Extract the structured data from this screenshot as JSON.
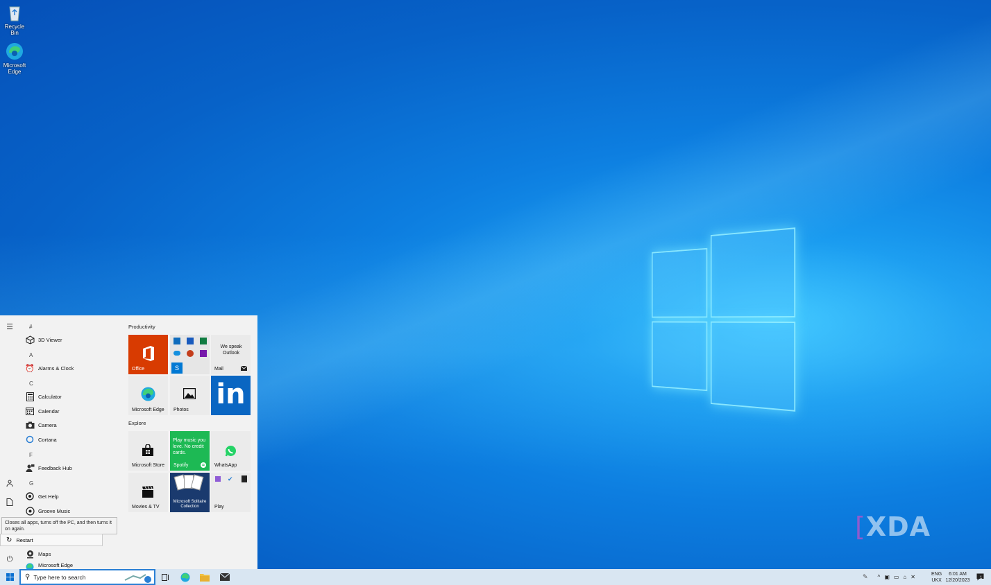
{
  "desktop": {
    "icons": [
      {
        "label": "Recycle Bin",
        "icon": "recycle-bin-icon"
      },
      {
        "label": "Microsoft Edge",
        "icon": "edge-icon"
      }
    ],
    "watermark": "XDA"
  },
  "start_menu": {
    "app_list": {
      "groups": [
        {
          "letter": "#",
          "apps": [
            "3D Viewer"
          ]
        },
        {
          "letter": "A",
          "apps": [
            "Alarms & Clock"
          ]
        },
        {
          "letter": "C",
          "apps": [
            "Calculator",
            "Calendar",
            "Camera",
            "Cortana"
          ]
        },
        {
          "letter": "F",
          "apps": [
            "Feedback Hub"
          ]
        },
        {
          "letter": "G",
          "apps": [
            "Get Help",
            "Groove Music"
          ]
        },
        {
          "letter": "",
          "apps": [
            "Maps",
            "Microsoft Edge"
          ]
        }
      ]
    },
    "tooltip": "Closes all apps, turns off the PC, and then turns it on again.",
    "restart_label": "Restart",
    "productivity": {
      "title": "Productivity",
      "tiles": {
        "office": "Office",
        "mail_promo": "We speak Outlook",
        "mail": "Mail",
        "edge": "Microsoft Edge",
        "photos": "Photos",
        "linkedin": "in"
      }
    },
    "explore": {
      "title": "Explore",
      "tiles": {
        "store": "Microsoft Store",
        "spotify_promo": "Play music you love. No credit cards.",
        "spotify": "Spotify",
        "whatsapp": "WhatsApp",
        "movies": "Movies & TV",
        "solitaire": "Microsoft Solitaire Collection",
        "play": "Play"
      }
    }
  },
  "taskbar": {
    "search_placeholder": "Type here to search",
    "lang_line1": "ENG",
    "lang_line2": "UKX",
    "time": "6:01 AM",
    "date": "12/20/2023",
    "notification_count": "1"
  },
  "colors": {
    "office": "#d83b01",
    "linkedin": "#0a66c2",
    "spotify": "#1db954",
    "solitaire": "#1a3a6e",
    "accent": "#2a7fd4"
  }
}
